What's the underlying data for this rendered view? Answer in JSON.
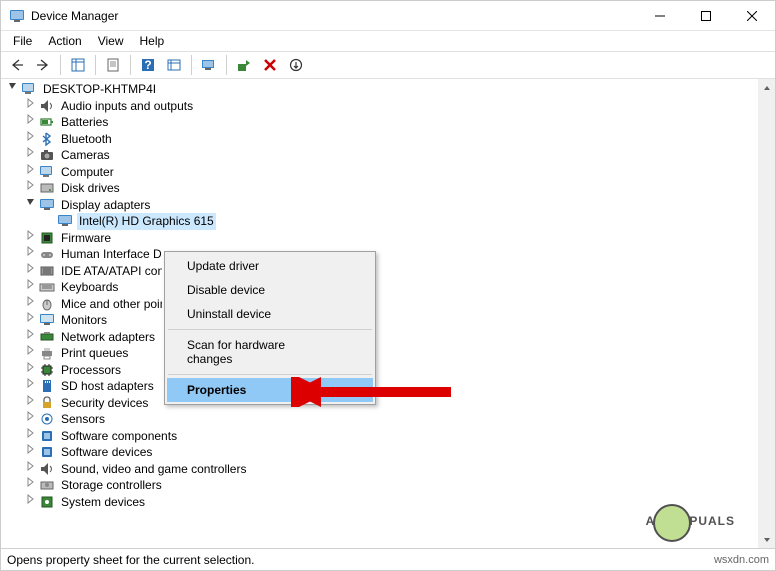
{
  "window": {
    "title": "Device Manager"
  },
  "menus": {
    "file": "File",
    "action": "Action",
    "view": "View",
    "help": "Help"
  },
  "root": "DESKTOP-KHTMP4I",
  "categories": [
    {
      "label": "Audio inputs and outputs",
      "expanded": false
    },
    {
      "label": "Batteries",
      "expanded": false
    },
    {
      "label": "Bluetooth",
      "expanded": false
    },
    {
      "label": "Cameras",
      "expanded": false
    },
    {
      "label": "Computer",
      "expanded": false
    },
    {
      "label": "Disk drives",
      "expanded": false
    },
    {
      "label": "Display adapters",
      "expanded": true,
      "children": [
        {
          "label": "Intel(R) HD Graphics 615",
          "selected": true
        }
      ]
    },
    {
      "label": "Firmware",
      "expanded": false
    },
    {
      "label": "Human Interface Devices",
      "expanded": false
    },
    {
      "label": "IDE ATA/ATAPI controllers",
      "expanded": false
    },
    {
      "label": "Keyboards",
      "expanded": false
    },
    {
      "label": "Mice and other pointing devices",
      "expanded": false
    },
    {
      "label": "Monitors",
      "expanded": false
    },
    {
      "label": "Network adapters",
      "expanded": false
    },
    {
      "label": "Print queues",
      "expanded": false
    },
    {
      "label": "Processors",
      "expanded": false
    },
    {
      "label": "SD host adapters",
      "expanded": false
    },
    {
      "label": "Security devices",
      "expanded": false
    },
    {
      "label": "Sensors",
      "expanded": false
    },
    {
      "label": "Software components",
      "expanded": false
    },
    {
      "label": "Software devices",
      "expanded": false
    },
    {
      "label": "Sound, video and game controllers",
      "expanded": false
    },
    {
      "label": "Storage controllers",
      "expanded": false
    },
    {
      "label": "System devices",
      "expanded": false
    }
  ],
  "context_menu": {
    "items": [
      {
        "label": "Update driver"
      },
      {
        "label": "Disable device"
      },
      {
        "label": "Uninstall device"
      },
      {
        "sep": true
      },
      {
        "label": "Scan for hardware changes"
      },
      {
        "sep": true
      },
      {
        "label": "Properties",
        "highlight": true
      }
    ]
  },
  "status": "Opens property sheet for the current selection.",
  "watermark": {
    "brand_pre": "A",
    "brand_post": "PUALS",
    "url": "wsxdn.com"
  }
}
